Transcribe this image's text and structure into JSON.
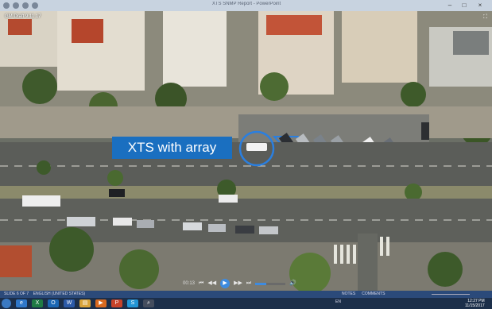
{
  "window": {
    "title": "XTS SNMP Report - PowerPoint",
    "minimize_glyph": "–",
    "maximize_glyph": "□",
    "close_glyph": "×"
  },
  "video": {
    "osd_label": "GM Draft 9.11.17",
    "fullscreen_glyph": "⛶",
    "annotation": "XTS with array",
    "time": "00:13",
    "progress": 0.35,
    "controls": {
      "skip_back": "⏮",
      "rewind": "◀◀",
      "play": "▶",
      "forward": "▶▶",
      "skip_forward": "⏭",
      "volume": "🔊"
    }
  },
  "statusbar": {
    "slide": "SLIDE 6 OF 7",
    "language": "ENGLISH (UNITED STATES)",
    "notes": "NOTES",
    "comments": "COMMENTS"
  },
  "taskbar": {
    "apps": [
      {
        "name": "ie",
        "glyph": "e",
        "color": "#2f77c9"
      },
      {
        "name": "excel",
        "glyph": "X",
        "color": "#1f7b45"
      },
      {
        "name": "outlook",
        "glyph": "O",
        "color": "#1b67b4"
      },
      {
        "name": "word",
        "glyph": "W",
        "color": "#2b5aa8"
      },
      {
        "name": "explorer",
        "glyph": "▤",
        "color": "#d8a33a"
      },
      {
        "name": "media",
        "glyph": "▶",
        "color": "#d96a20"
      },
      {
        "name": "powerpoint",
        "glyph": "P",
        "color": "#c7432a"
      },
      {
        "name": "skype",
        "glyph": "S",
        "color": "#2395d6"
      },
      {
        "name": "search",
        "glyph": "⌕",
        "color": "#444d5e"
      }
    ],
    "tray_lang": "EN",
    "clock_time": "12:27 PM",
    "clock_date": "11/15/2017"
  },
  "colors": {
    "accent": "#1a6fc0",
    "highlight_ring": "#2a7fe0",
    "road": "#5b5d59"
  }
}
